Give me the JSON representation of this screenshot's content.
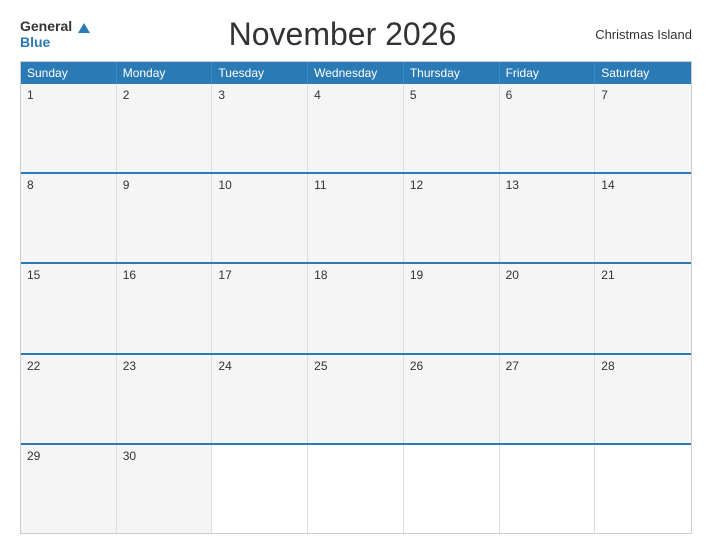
{
  "header": {
    "title": "November 2026",
    "region": "Christmas Island",
    "logo_general": "General",
    "logo_blue": "Blue"
  },
  "days_of_week": [
    "Sunday",
    "Monday",
    "Tuesday",
    "Wednesday",
    "Thursday",
    "Friday",
    "Saturday"
  ],
  "weeks": [
    [
      {
        "num": "1",
        "empty": false
      },
      {
        "num": "2",
        "empty": false
      },
      {
        "num": "3",
        "empty": false
      },
      {
        "num": "4",
        "empty": false
      },
      {
        "num": "5",
        "empty": false
      },
      {
        "num": "6",
        "empty": false
      },
      {
        "num": "7",
        "empty": false
      }
    ],
    [
      {
        "num": "8",
        "empty": false
      },
      {
        "num": "9",
        "empty": false
      },
      {
        "num": "10",
        "empty": false
      },
      {
        "num": "11",
        "empty": false
      },
      {
        "num": "12",
        "empty": false
      },
      {
        "num": "13",
        "empty": false
      },
      {
        "num": "14",
        "empty": false
      }
    ],
    [
      {
        "num": "15",
        "empty": false
      },
      {
        "num": "16",
        "empty": false
      },
      {
        "num": "17",
        "empty": false
      },
      {
        "num": "18",
        "empty": false
      },
      {
        "num": "19",
        "empty": false
      },
      {
        "num": "20",
        "empty": false
      },
      {
        "num": "21",
        "empty": false
      }
    ],
    [
      {
        "num": "22",
        "empty": false
      },
      {
        "num": "23",
        "empty": false
      },
      {
        "num": "24",
        "empty": false
      },
      {
        "num": "25",
        "empty": false
      },
      {
        "num": "26",
        "empty": false
      },
      {
        "num": "27",
        "empty": false
      },
      {
        "num": "28",
        "empty": false
      }
    ],
    [
      {
        "num": "29",
        "empty": false
      },
      {
        "num": "30",
        "empty": false
      },
      {
        "num": "",
        "empty": true
      },
      {
        "num": "",
        "empty": true
      },
      {
        "num": "",
        "empty": true
      },
      {
        "num": "",
        "empty": true
      },
      {
        "num": "",
        "empty": true
      }
    ]
  ]
}
